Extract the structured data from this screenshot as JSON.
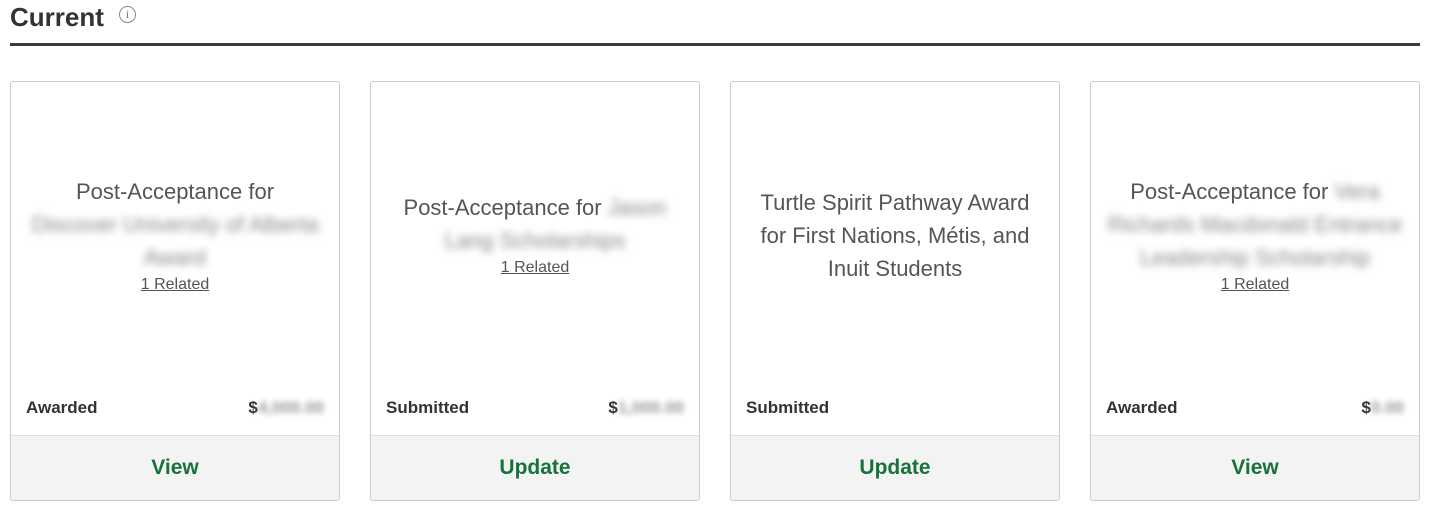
{
  "header": {
    "title": "Current",
    "info_icon": "info-icon",
    "info_glyph": "i"
  },
  "cards": [
    {
      "title_prefix": "Post-Acceptance for",
      "title_blurred": "Discover University of Alberta Award",
      "related": "1 Related",
      "status": "Awarded",
      "currency": "$",
      "amount_blurred": "4,000.00",
      "action": "View"
    },
    {
      "title_prefix": "Post-Acceptance for",
      "title_blurred": "Jason Lang Scholarships",
      "related": "1 Related",
      "status": "Submitted",
      "currency": "$",
      "amount_blurred": "1,000.00",
      "action": "Update"
    },
    {
      "title_prefix": "Turtle Spirit Pathway Award for First Nations, Métis, and Inuit Students",
      "title_blurred": "",
      "related": "",
      "status": "Submitted",
      "currency": "",
      "amount_blurred": "",
      "action": "Update"
    },
    {
      "title_prefix": "Post-Acceptance for",
      "title_blurred": "Vera Richards Macdonald Entrance Leadership Scholarship",
      "related": "1 Related",
      "status": "Awarded",
      "currency": "$",
      "amount_blurred": "0.00",
      "action": "View"
    }
  ],
  "colors": {
    "action_green": "#17723a",
    "footer_bg": "#f3f3f3",
    "header_rule": "#3a3a3a"
  }
}
